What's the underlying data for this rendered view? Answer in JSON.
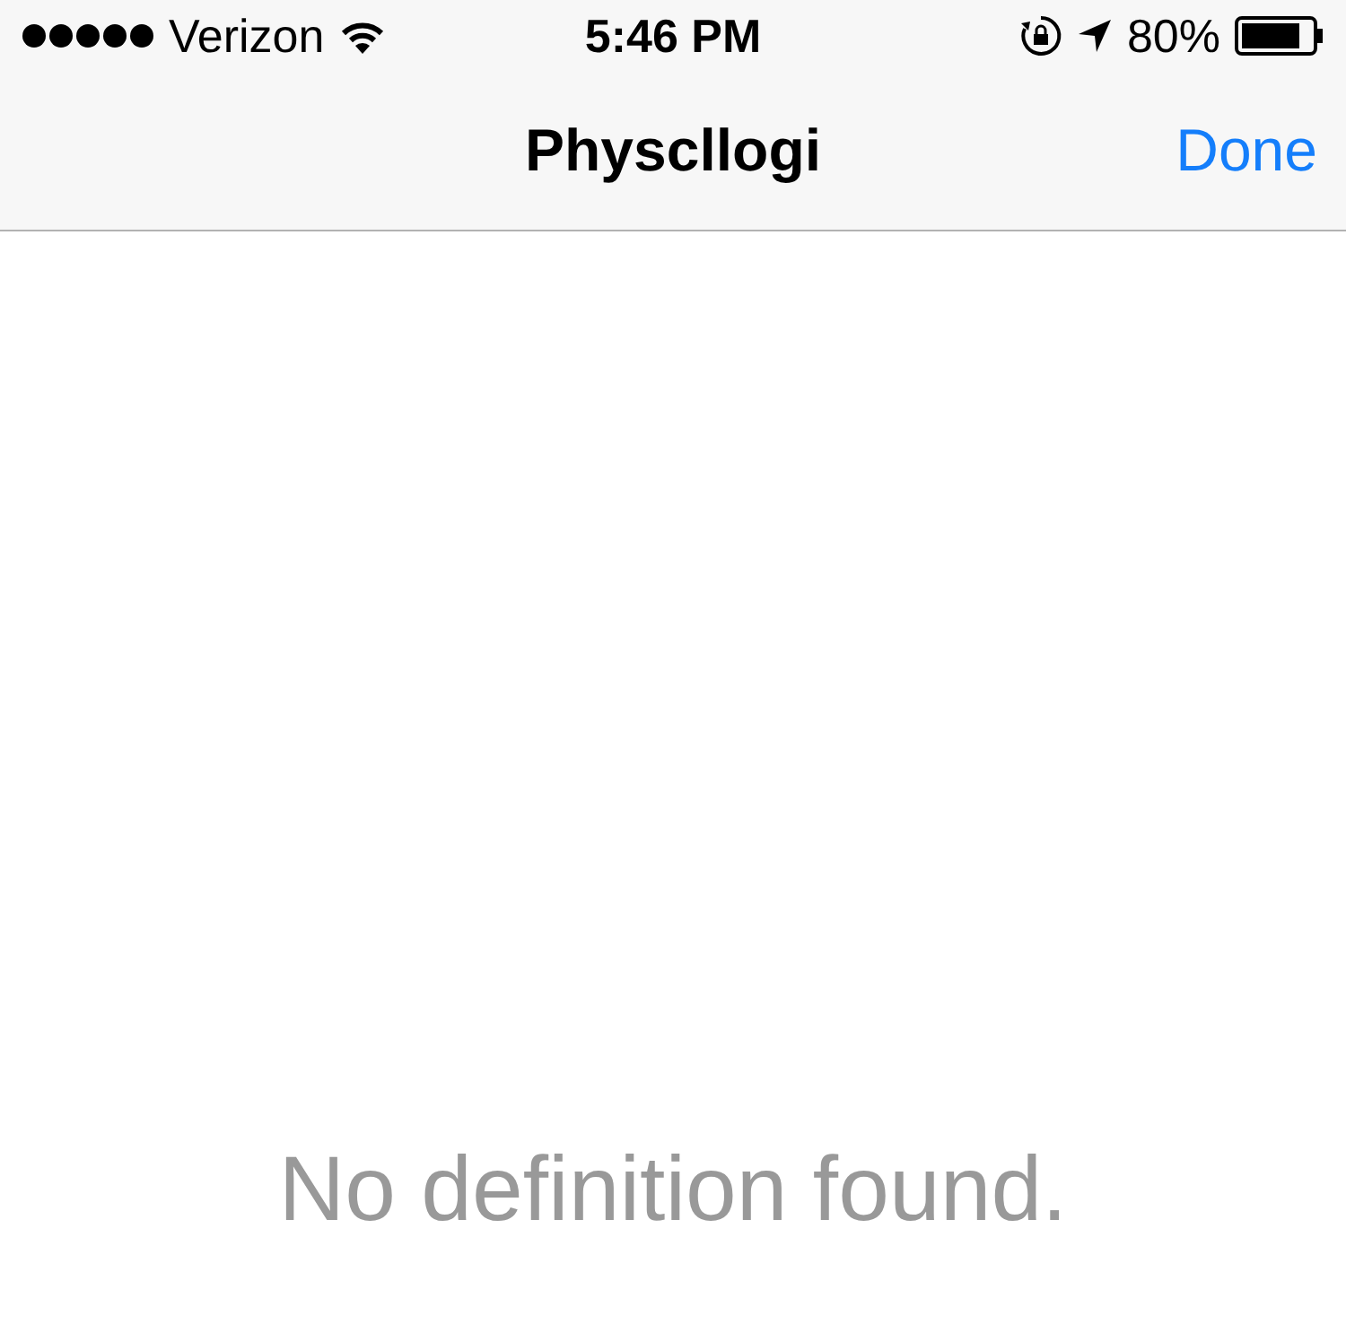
{
  "status_bar": {
    "carrier": "Verizon",
    "time": "5:46 PM",
    "battery": "80%"
  },
  "nav_bar": {
    "title": "Physcllogi",
    "done": "Done"
  },
  "content": {
    "message": "No definition found."
  }
}
